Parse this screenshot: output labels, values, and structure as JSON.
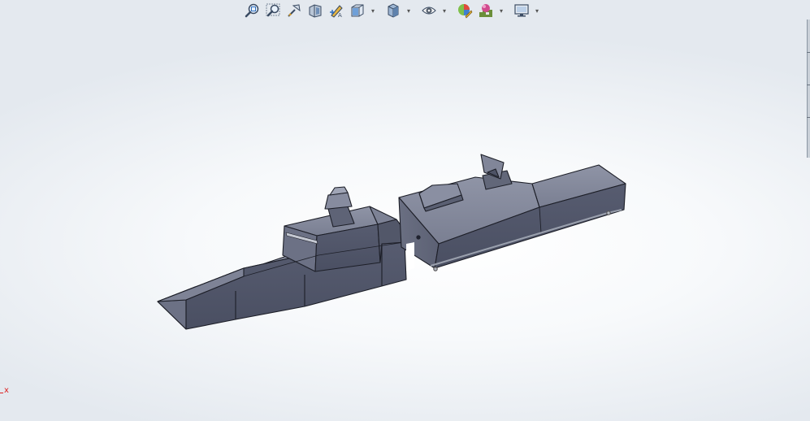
{
  "viewport": {
    "background_colors": {
      "center": "#ffffff",
      "edge": "#e4e9ef"
    },
    "model_color": "#5d6275",
    "triad_axis_label": "x"
  },
  "toolbar": {
    "items": [
      {
        "icon": "zoom-to-fit-icon",
        "dropdown": false
      },
      {
        "icon": "zoom-to-area-icon",
        "dropdown": false
      },
      {
        "icon": "previous-view-icon",
        "dropdown": false
      },
      {
        "icon": "section-view-icon",
        "dropdown": false
      },
      {
        "icon": "dynamic-annotation-views-icon",
        "dropdown": false
      },
      {
        "icon": "view-orientation-icon",
        "dropdown": true
      },
      {
        "icon": "display-style-icon",
        "dropdown": true
      },
      {
        "icon": "hide-show-items-icon",
        "dropdown": true
      },
      {
        "icon": "edit-appearance-icon",
        "dropdown": false
      },
      {
        "icon": "apply-scene-icon",
        "dropdown": true
      },
      {
        "icon": "view-settings-icon",
        "dropdown": true
      }
    ]
  }
}
